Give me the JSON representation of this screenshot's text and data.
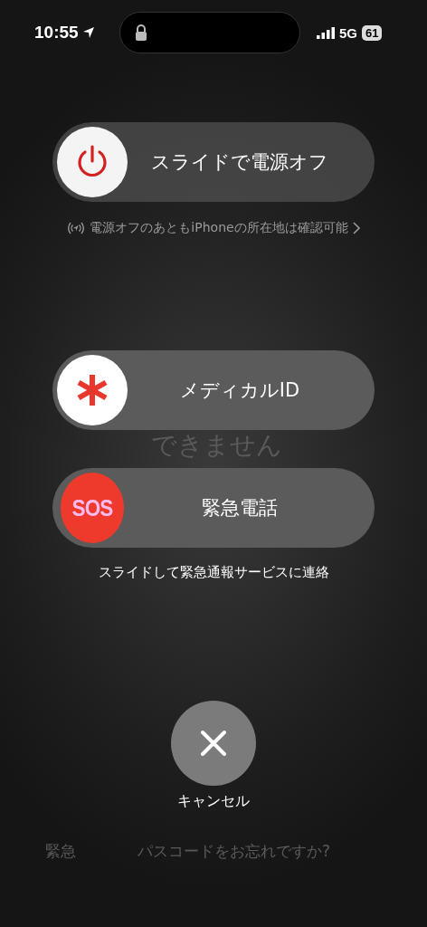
{
  "status_bar": {
    "time": "10:55",
    "network": "5G",
    "battery": "61"
  },
  "sliders": [
    {
      "kind": "power",
      "label": "スライドで電源オフ",
      "hint": "電源オフのあともiPhoneの所在地は確認可能"
    },
    {
      "kind": "medical",
      "label": "メディカルID"
    },
    {
      "kind": "sos",
      "knob_text": "SOS",
      "label": "緊急電話",
      "hint": "スライドして緊急通報サービスに連絡"
    }
  ],
  "cancel": {
    "label": "キャンセル"
  },
  "background_texts": [
    "できません",
    "緊急",
    "パスコードをお忘れですか?"
  ]
}
